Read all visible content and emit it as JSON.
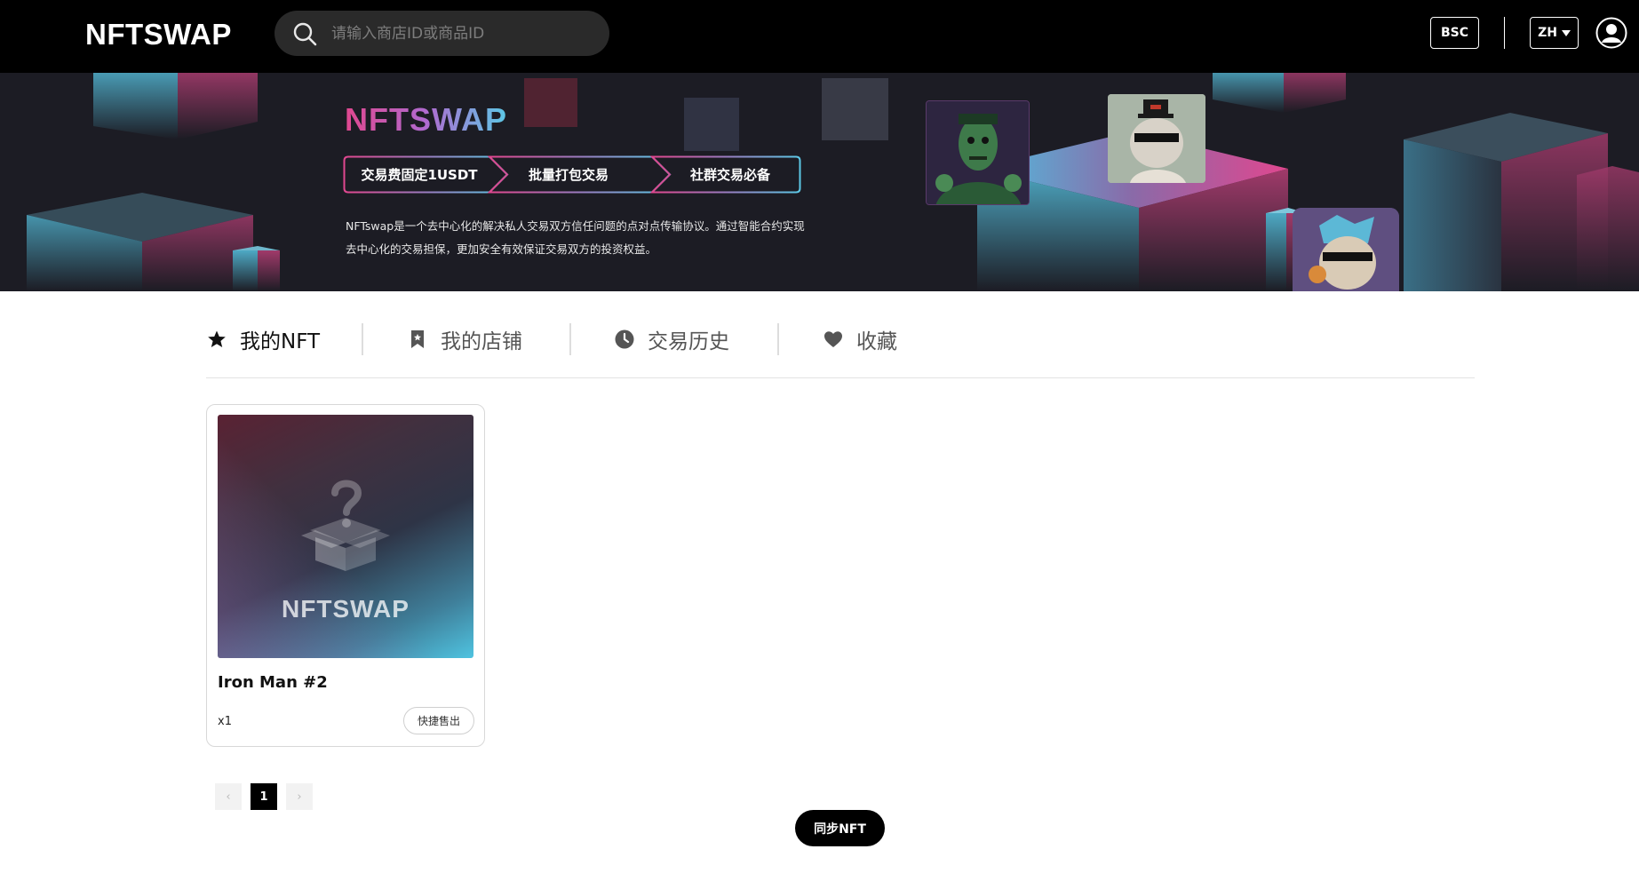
{
  "header": {
    "logo": "NFTSWAP",
    "search_placeholder": "请输入商店ID或商品ID",
    "chain": "BSC",
    "language": "ZH"
  },
  "banner": {
    "logo": "NFTSWAP",
    "tags": [
      "交易费固定1USDT",
      "批量打包交易",
      "社群交易必备"
    ],
    "description_line1": "NFTswap是一个去中心化的解决私人交易双方信任问题的点对点传输协议。通过智能合约实现",
    "description_line2": "去中心化的交易担保，更加安全有效保证交易双方的投资权益。",
    "colors": {
      "pink": "#e0478f",
      "cyan": "#5cc8e6",
      "bg": "#1c1c24"
    }
  },
  "tabs": [
    {
      "label": "我的NFT",
      "icon": "star-icon",
      "active": true
    },
    {
      "label": "我的店铺",
      "icon": "bookmark-icon",
      "active": false
    },
    {
      "label": "交易历史",
      "icon": "clock-icon",
      "active": false
    },
    {
      "label": "收藏",
      "icon": "heart-icon",
      "active": false
    }
  ],
  "nft_cards": [
    {
      "title": "Iron Man #2",
      "quantity": "x1",
      "thumbnail_brand": "NFTSWAP",
      "action_label": "快捷售出"
    }
  ],
  "pagination": {
    "prev": "‹",
    "current": "1",
    "next": "›"
  },
  "sync_button": "同步NFT"
}
